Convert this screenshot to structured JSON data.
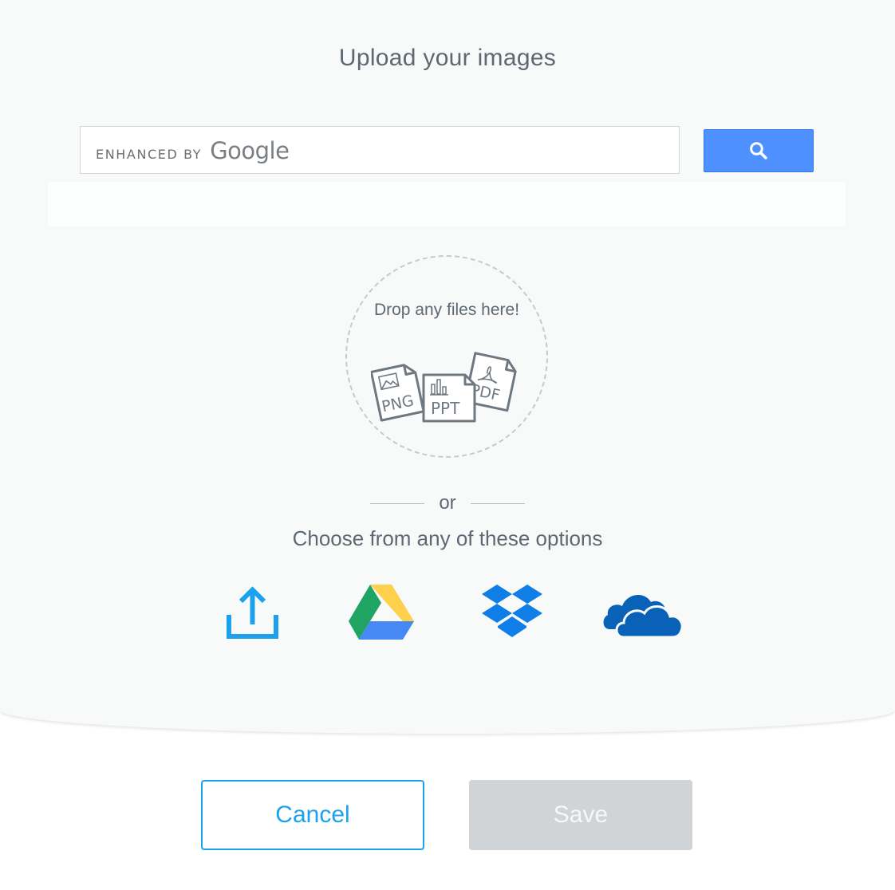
{
  "dialog": {
    "title": "Upload your images"
  },
  "search": {
    "placeholder": "",
    "value": "",
    "watermark_prefix": "ENHANCED BY",
    "watermark_brand": "Google",
    "button_icon": "search-icon",
    "button_color": "#4d90fe"
  },
  "drop_zone": {
    "text": "Drop any files here!",
    "file_types": [
      "PNG",
      "PPT",
      "PDF"
    ]
  },
  "divider": {
    "text": "or"
  },
  "sources": {
    "heading": "Choose from any of these options",
    "items": [
      {
        "icon": "upload-icon",
        "color": "#1ca2ec"
      },
      {
        "icon": "google-drive-icon",
        "colors": [
          "#1fa463",
          "#ffd04b",
          "#4688f4"
        ]
      },
      {
        "icon": "dropbox-icon",
        "color": "#0f7ee6"
      },
      {
        "icon": "onedrive-icon",
        "color": "#0a62b8"
      }
    ]
  },
  "footer": {
    "cancel_label": "Cancel",
    "save_label": "Save",
    "accent_color": "#1ca2ec",
    "disabled_color": "#d0d4d7"
  }
}
